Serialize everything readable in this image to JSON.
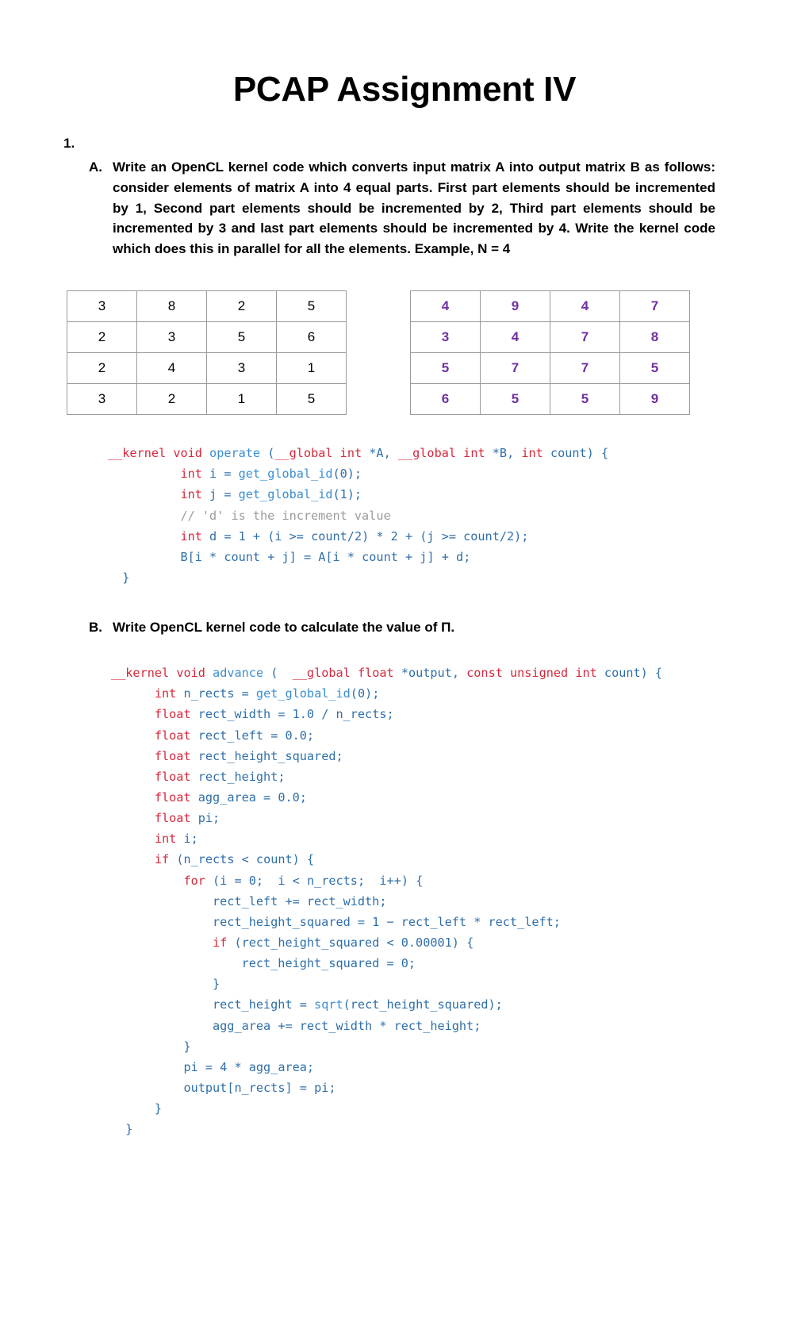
{
  "document": {
    "title": "PCAP Assignment IV"
  },
  "question1": {
    "number": "1.",
    "parts": [
      {
        "marker": "A.",
        "text": "Write an OpenCL kernel code which converts input matrix A into output matrix B as follows: consider elements of matrix A into 4 equal parts. First part elements should be incremented by 1, Second part elements should be incremented by 2, Third part elements should be incremented by 3 and last part elements should be incremented by 4. Write the kernel code which does this in parallel for all the elements. Example, N = 4"
      },
      {
        "marker": "B.",
        "text": "Write OpenCL kernel code to calculate the value of Π."
      }
    ]
  },
  "matrices": {
    "input": {
      "name": "matrix-a",
      "text_color": "#000000",
      "rows": [
        [
          "3",
          "8",
          "2",
          "5"
        ],
        [
          "2",
          "3",
          "5",
          "6"
        ],
        [
          "2",
          "4",
          "3",
          "1"
        ],
        [
          "3",
          "2",
          "1",
          "5"
        ]
      ]
    },
    "output": {
      "name": "matrix-b",
      "text_color": "#7030a0",
      "rows": [
        [
          "4",
          "9",
          "4",
          "7"
        ],
        [
          "3",
          "4",
          "7",
          "8"
        ],
        [
          "5",
          "7",
          "7",
          "5"
        ],
        [
          "6",
          "5",
          "5",
          "9"
        ]
      ]
    }
  },
  "code_blocks": {
    "kernel_operate": {
      "language": "opencl",
      "lines": [
        "__kernel void operate (__global int *A, __global int *B, int count) {",
        "          int i = get_global_id(0);",
        "          int j = get_global_id(1);",
        "          // 'd' is the increment value",
        "          int d = 1 + (i >= count/2) * 2 + (j >= count/2);",
        "          B[i * count + j] = A[i * count + j] + d;",
        "  }"
      ],
      "plain_text": "__kernel void operate (__global int *A, __global int *B, int count) {\n          int i = get_global_id(0);\n          int j = get_global_id(1);\n          // 'd' is the increment value\n          int d = 1 + (i >= count/2) * 2 + (j >= count/2);\n          B[i * count + j] = A[i * count + j] + d;\n  }"
    },
    "kernel_advance": {
      "language": "opencl",
      "lines": [
        "__kernel void advance (  __global float *output, const unsigned int count) {",
        "      int n_rects = get_global_id(0);",
        "      float rect_width = 1.0 / n_rects;",
        "      float rect_left = 0.0;",
        "      float rect_height_squared;",
        "      float rect_height;",
        "      float agg_area = 0.0;",
        "      float pi;",
        "      int i;",
        "      if (n_rects < count) {",
        "          for (i = 0;  i < n_rects;  i++) {",
        "              rect_left += rect_width;",
        "              rect_height_squared = 1 − rect_left * rect_left;",
        "              if (rect_height_squared < 0.00001) {",
        "                  rect_height_squared = 0;",
        "              }",
        "              rect_height = sqrt(rect_height_squared);",
        "              agg_area += rect_width * rect_height;",
        "          }",
        "          pi = 4 * agg_area;",
        "          output[n_rects] = pi;",
        "      }",
        "  }"
      ],
      "plain_text": "__kernel void advance (  __global float *output, const unsigned int count) {\n      int n_rects = get_global_id(0);\n      float rect_width = 1.0 / n_rects;\n      float rect_left = 0.0;\n      float rect_height_squared;\n      float rect_height;\n      float agg_area = 0.0;\n      float pi;\n      int i;\n      if (n_rects < count) {\n          for (i = 0;  i < n_rects;  i++) {\n              rect_left += rect_width;\n              rect_height_squared = 1 − rect_left * rect_left;\n              if (rect_height_squared < 0.00001) {\n                  rect_height_squared = 0;\n              }\n              rect_height = sqrt(rect_height_squared);\n              agg_area += rect_width * rect_height;\n          }\n          pi = 4 * agg_area;\n          output[n_rects] = pi;\n      }\n  }"
    }
  },
  "syntax_colors": {
    "keyword": "#d6283c",
    "function": "#3a8fd0",
    "identifier": "#2f6fa8",
    "comment": "#9b9b9b"
  }
}
